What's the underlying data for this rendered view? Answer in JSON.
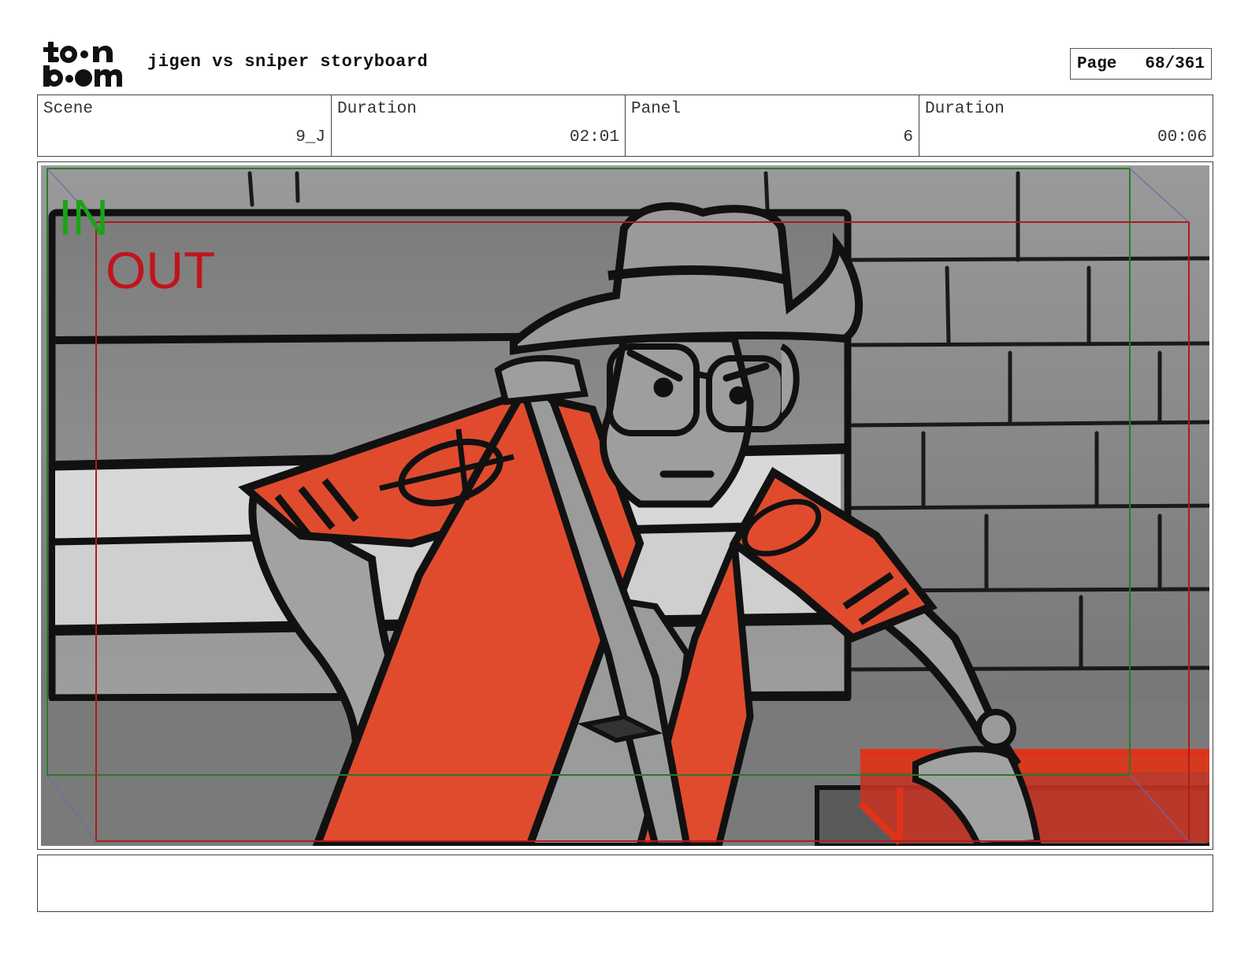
{
  "header": {
    "logo_icon": "toon-boom-logo",
    "title": "jigen vs sniper storyboard",
    "page_label": "Page",
    "page_value": "68/361"
  },
  "info": {
    "scene_label": "Scene",
    "scene_value": "9_J",
    "scene_duration_label": "Duration",
    "scene_duration_value": "02:01",
    "panel_label": "Panel",
    "panel_value": "6",
    "panel_duration_label": "Duration",
    "panel_duration_value": "00:06"
  },
  "panel": {
    "in_label": "IN",
    "out_label": "OUT",
    "in_color": "#1aa31a",
    "out_color": "#c0141c",
    "jacket_color": "#e04b2e"
  },
  "notes": {
    "text": ""
  }
}
